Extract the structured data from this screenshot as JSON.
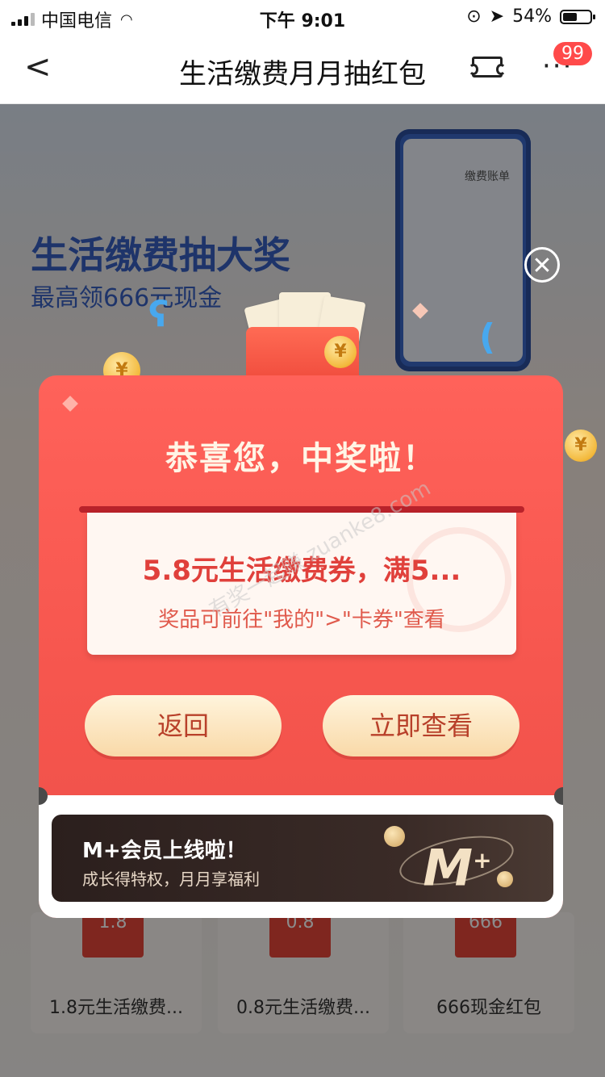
{
  "status_bar": {
    "carrier": "中国电信",
    "time": "下午 9:01",
    "battery": "54%",
    "battery_level": 0.54
  },
  "nav": {
    "title": "生活缴费月月抽红包",
    "badge": "99",
    "more": "···"
  },
  "background": {
    "headline": "生活缴费抽大奖",
    "subheadline": "最高领666元现金",
    "phone_header": "缴费账单",
    "prize_cards": [
      {
        "amount": "1.8",
        "label": "1.8元生活缴费..."
      },
      {
        "amount": "0.8",
        "label": "0.8元生活缴费..."
      },
      {
        "amount": "666",
        "label": "666现金红包"
      }
    ]
  },
  "modal": {
    "title": "恭喜您，中奖啦！",
    "prize_name": "5.8元生活缴费券，满5...",
    "prize_hint": "奖品可前往\"我的\">\"卡券\"查看",
    "back_label": "返回",
    "view_label": "立即查看",
    "close_symbol": "✕"
  },
  "banner": {
    "title": "M+会员上线啦！",
    "subtitle": "成长得特权，月月享福利",
    "logo": "M",
    "logo_sup": "+"
  },
  "watermark": {
    "text": "有奖一起赚 zuanke8.com"
  },
  "colors": {
    "modal_red": "#f6564e",
    "button_cream": "#f9d9a8",
    "headline_blue": "#3760c2",
    "banner_dark": "#2b1f1d"
  }
}
